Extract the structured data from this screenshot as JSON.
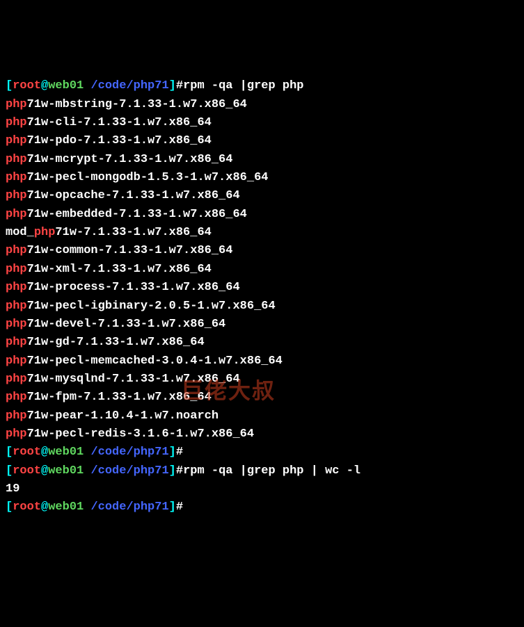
{
  "prompts": [
    {
      "user": "root",
      "at": "@",
      "host": "web01",
      "path": "/code/php71",
      "command": "rpm -qa |grep php"
    },
    {
      "user": "root",
      "at": "@",
      "host": "web01",
      "path": "/code/php71",
      "command": ""
    },
    {
      "user": "root",
      "at": "@",
      "host": "web01",
      "path": "/code/php71",
      "command": "rpm -qa |grep php | wc -l"
    },
    {
      "user": "root",
      "at": "@",
      "host": "web01",
      "path": "/code/php71",
      "command": ""
    }
  ],
  "packages": [
    {
      "hl": "php",
      "rest": "71w-mbstring-7.1.33-1.w7.x86_64"
    },
    {
      "hl": "php",
      "rest": "71w-cli-7.1.33-1.w7.x86_64"
    },
    {
      "hl": "php",
      "rest": "71w-pdo-7.1.33-1.w7.x86_64"
    },
    {
      "hl": "php",
      "rest": "71w-mcrypt-7.1.33-1.w7.x86_64"
    },
    {
      "hl": "php",
      "rest": "71w-pecl-mongodb-1.5.3-1.w7.x86_64"
    },
    {
      "hl": "php",
      "rest": "71w-opcache-7.1.33-1.w7.x86_64"
    },
    {
      "hl": "php",
      "rest": "71w-embedded-7.1.33-1.w7.x86_64"
    },
    {
      "prefix": "mod_",
      "hl": "php",
      "rest": "71w-7.1.33-1.w7.x86_64"
    },
    {
      "hl": "php",
      "rest": "71w-common-7.1.33-1.w7.x86_64"
    },
    {
      "hl": "php",
      "rest": "71w-xml-7.1.33-1.w7.x86_64"
    },
    {
      "hl": "php",
      "rest": "71w-process-7.1.33-1.w7.x86_64"
    },
    {
      "hl": "php",
      "rest": "71w-pecl-igbinary-2.0.5-1.w7.x86_64"
    },
    {
      "hl": "php",
      "rest": "71w-devel-7.1.33-1.w7.x86_64"
    },
    {
      "hl": "php",
      "rest": "71w-gd-7.1.33-1.w7.x86_64"
    },
    {
      "hl": "php",
      "rest": "71w-pecl-memcached-3.0.4-1.w7.x86_64"
    },
    {
      "hl": "php",
      "rest": "71w-mysqlnd-7.1.33-1.w7.x86_64"
    },
    {
      "hl": "php",
      "rest": "71w-fpm-7.1.33-1.w7.x86_64"
    },
    {
      "hl": "php",
      "rest": "71w-pear-1.10.4-1.w7.noarch"
    },
    {
      "hl": "php",
      "rest": "71w-pecl-redis-3.1.6-1.w7.x86_64"
    }
  ],
  "count_output": "19",
  "brackets": {
    "open": "[",
    "close": "]",
    "hash": "#"
  },
  "watermark": "巨佬大叔"
}
